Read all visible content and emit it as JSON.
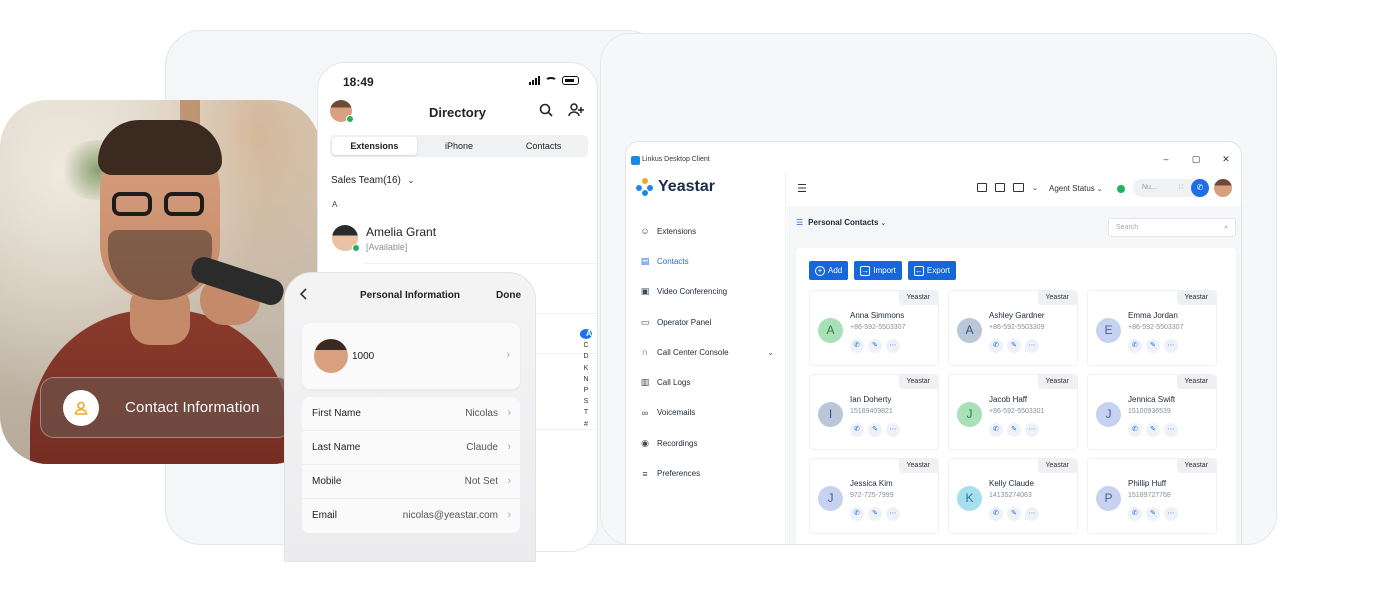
{
  "photo": {
    "contact_label": "Contact Information"
  },
  "mobile": {
    "time": "18:49",
    "title": "Directory",
    "tabs": [
      "Extensions",
      "iPhone",
      "Contacts"
    ],
    "active_tab": "Extensions",
    "team": "Sales Team(16)",
    "section_letter": "A",
    "contact": {
      "name": "Amelia Grant",
      "status": "[Available]"
    },
    "alphabet": [
      "A",
      "C",
      "D",
      "K",
      "N",
      "P",
      "S",
      "T",
      "#"
    ],
    "personal_info": {
      "title": "Personal Information",
      "done": "Done",
      "extension": "1000",
      "fields": [
        {
          "label": "First Name",
          "value": "Nicolas"
        },
        {
          "label": "Last Name",
          "value": "Claude"
        },
        {
          "label": "Mobile",
          "value": "Not Set"
        },
        {
          "label": "Email",
          "value": "nicolas@yeastar.com"
        }
      ]
    }
  },
  "desktop": {
    "window_title": "Linkus Desktop Client",
    "brand": "Yeastar",
    "nav": [
      {
        "label": "Extensions",
        "icon": "users-icon"
      },
      {
        "label": "Contacts",
        "icon": "contacts-book-icon",
        "active": true
      },
      {
        "label": "Video Conferencing",
        "icon": "video-icon"
      },
      {
        "label": "Operator Panel",
        "icon": "monitor-icon"
      },
      {
        "label": "Call Center Console",
        "icon": "headset-icon",
        "expandable": true
      },
      {
        "label": "Call Logs",
        "icon": "call-log-icon"
      },
      {
        "label": "Voicemails",
        "icon": "voicemail-icon"
      },
      {
        "label": "Recordings",
        "icon": "recording-icon"
      },
      {
        "label": "Preferences",
        "icon": "preferences-icon"
      }
    ],
    "agent_status": "Agent Status",
    "dial_placeholder": "Nu...",
    "section": "Personal Contacts",
    "search_placeholder": "Search",
    "actions": [
      "Add",
      "Import",
      "Export"
    ],
    "contacts": [
      {
        "initial": "A",
        "name": "Anna Simmons",
        "phone": "+86-592-5503307",
        "tag": "Yeastar",
        "color": "#a8e0b8",
        "text": "#2e7d4a"
      },
      {
        "initial": "A",
        "name": "Ashley Gardner",
        "phone": "+86-592-5503309",
        "tag": "Yeastar",
        "color": "#b9c7d9",
        "text": "#3e5573"
      },
      {
        "initial": "E",
        "name": "Emma Jordan",
        "phone": "+86-592-5503307",
        "tag": "Yeastar",
        "color": "#c6d2f0",
        "text": "#4a5f9a"
      },
      {
        "initial": "I",
        "name": "Ian Doherty",
        "phone": "15189409821",
        "tag": "Yeastar",
        "color": "#b9c7d9",
        "text": "#3e5573"
      },
      {
        "initial": "J",
        "name": "Jacob Haff",
        "phone": "+86-592-5503301",
        "tag": "Yeastar",
        "color": "#a8e0b8",
        "text": "#2e7d4a"
      },
      {
        "initial": "J",
        "name": "Jennica Swift",
        "phone": "15100936539",
        "tag": "Yeastar",
        "color": "#c6d2f0",
        "text": "#4a5f9a"
      },
      {
        "initial": "J",
        "name": "Jessica Kim",
        "phone": "972-725-7999",
        "tag": "Yeastar",
        "color": "#c6d2f0",
        "text": "#4a5f9a"
      },
      {
        "initial": "K",
        "name": "Kelly Claude",
        "phone": "14135274063",
        "tag": "Yeastar",
        "color": "#a8dff0",
        "text": "#2a7390"
      },
      {
        "initial": "P",
        "name": "Phillip Huff",
        "phone": "15189727768",
        "tag": "Yeastar",
        "color": "#c6d2f0",
        "text": "#4a5f9a"
      }
    ]
  }
}
